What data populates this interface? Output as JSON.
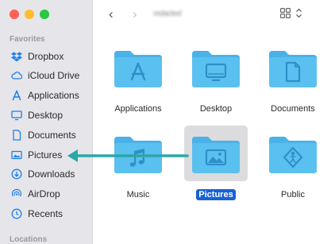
{
  "window": {
    "path_title": "redacted"
  },
  "sidebar": {
    "favorites_title": "Favorites",
    "locations_title": "Locations",
    "items": [
      {
        "label": "Dropbox",
        "icon": "dropbox-icon"
      },
      {
        "label": "iCloud Drive",
        "icon": "cloud-icon"
      },
      {
        "label": "Applications",
        "icon": "applications-icon"
      },
      {
        "label": "Desktop",
        "icon": "desktop-icon"
      },
      {
        "label": "Documents",
        "icon": "document-icon"
      },
      {
        "label": "Pictures",
        "icon": "picture-icon"
      },
      {
        "label": "Downloads",
        "icon": "download-icon"
      },
      {
        "label": "AirDrop",
        "icon": "airdrop-icon"
      },
      {
        "label": "Recents",
        "icon": "clock-icon"
      }
    ]
  },
  "toolbar": {
    "back": "‹",
    "forward": "›"
  },
  "grid": {
    "items": [
      {
        "label": "Applications",
        "icon": "applications-glyph"
      },
      {
        "label": "Desktop",
        "icon": "desktop-glyph"
      },
      {
        "label": "Documents",
        "icon": "document-glyph"
      },
      {
        "label": "Music",
        "icon": "music-glyph"
      },
      {
        "label": "Pictures",
        "icon": "picture-glyph",
        "selected": true
      },
      {
        "label": "Public",
        "icon": "public-glyph"
      }
    ]
  },
  "colors": {
    "folder": "#5ac0f0",
    "folder_tab": "#4ab2e6",
    "glyph": "#2f8fc9",
    "sidebar_icon": "#1a7ff0",
    "selection": "#1861d6",
    "arrow": "#2aa8a8"
  }
}
